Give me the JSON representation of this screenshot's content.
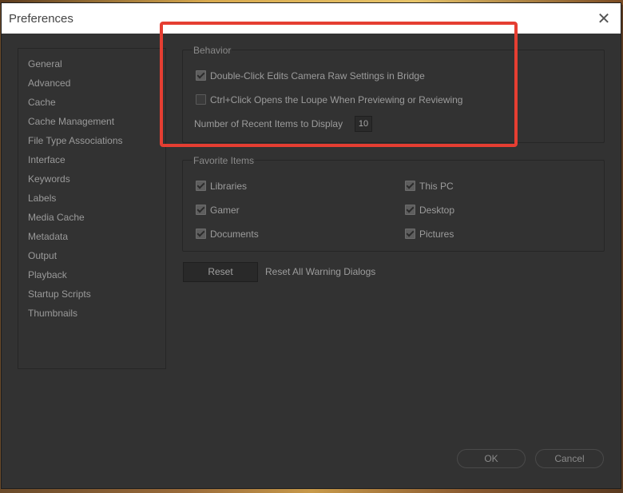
{
  "window": {
    "title": "Preferences",
    "close_glyph": "✕"
  },
  "nav": {
    "items": [
      {
        "label": "General"
      },
      {
        "label": "Advanced"
      },
      {
        "label": "Cache"
      },
      {
        "label": "Cache Management"
      },
      {
        "label": "File Type Associations"
      },
      {
        "label": "Interface"
      },
      {
        "label": "Keywords"
      },
      {
        "label": "Labels"
      },
      {
        "label": "Media Cache"
      },
      {
        "label": "Metadata"
      },
      {
        "label": "Output"
      },
      {
        "label": "Playback"
      },
      {
        "label": "Startup Scripts"
      },
      {
        "label": "Thumbnails"
      }
    ]
  },
  "behavior": {
    "group_label": "Behavior",
    "double_click": {
      "label": "Double-Click Edits Camera Raw Settings in Bridge",
      "checked": true
    },
    "ctrl_click": {
      "label": "Ctrl+Click Opens the Loupe When Previewing or Reviewing",
      "checked": false
    },
    "recent_items_label": "Number of Recent Items to Display",
    "recent_items_value": "10"
  },
  "favorites": {
    "group_label": "Favorite Items",
    "items": [
      {
        "label": "Libraries",
        "checked": true
      },
      {
        "label": "Gamer",
        "checked": true
      },
      {
        "label": "Documents",
        "checked": true
      },
      {
        "label": "This PC",
        "checked": true
      },
      {
        "label": "Desktop",
        "checked": true
      },
      {
        "label": "Pictures",
        "checked": true
      }
    ]
  },
  "reset": {
    "button_label": "Reset",
    "description": "Reset All Warning Dialogs"
  },
  "footer": {
    "ok_label": "OK",
    "cancel_label": "Cancel"
  },
  "colors": {
    "dialog_bg": "#323232",
    "highlight": "#e53e32"
  }
}
